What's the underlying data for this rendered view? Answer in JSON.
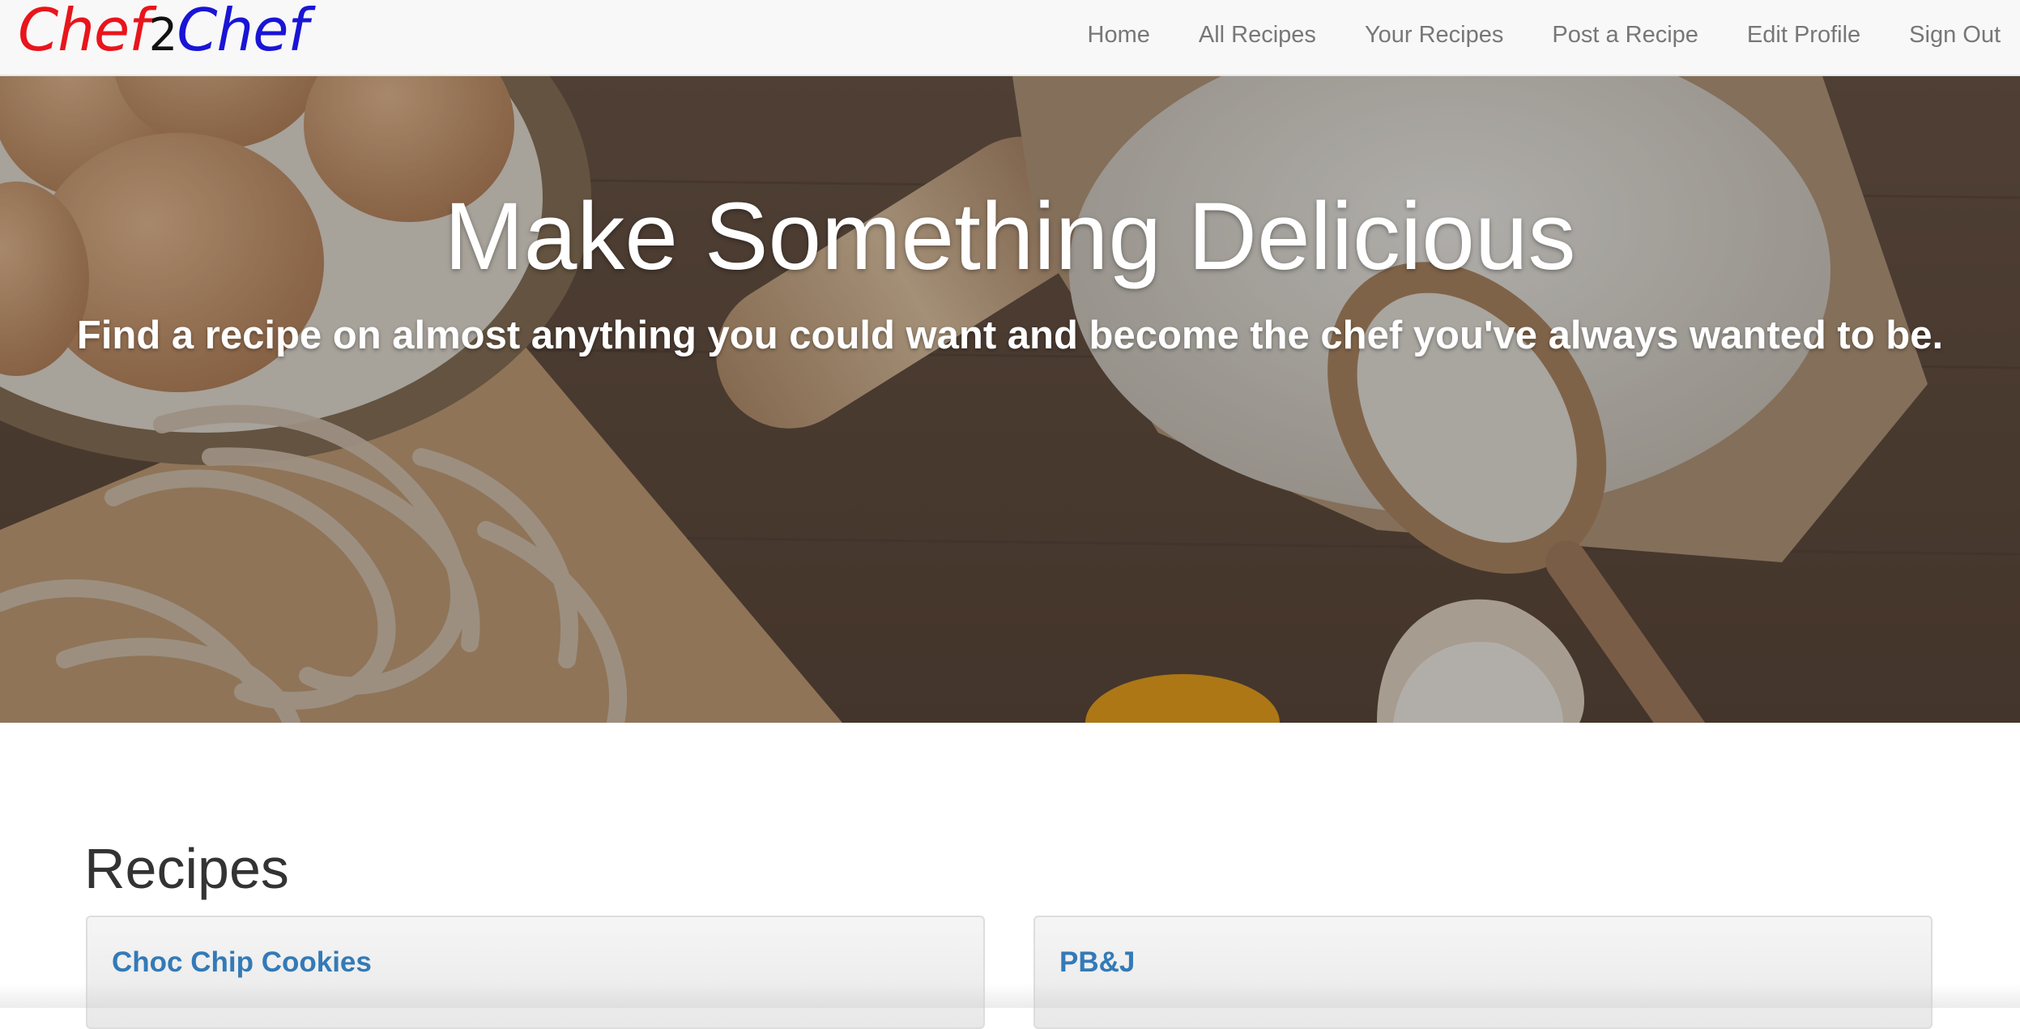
{
  "brand": {
    "part1": "Chef",
    "part2": "2",
    "part3": "Chef",
    "color1": "#e8151b",
    "color2": "#111111",
    "color3": "#1a14d6"
  },
  "nav": {
    "items": [
      {
        "label": "Home"
      },
      {
        "label": "All Recipes"
      },
      {
        "label": "Your Recipes"
      },
      {
        "label": "Post a Recipe"
      },
      {
        "label": "Edit Profile"
      },
      {
        "label": "Sign Out"
      }
    ]
  },
  "hero": {
    "title": "Make Something Delicious",
    "subtitle": "Find a recipe on almost anything you could want and become the chef you've always wanted to be."
  },
  "recipes": {
    "heading": "Recipes",
    "cards": [
      {
        "title": "Choc Chip Cookies"
      },
      {
        "title": "PB&J"
      }
    ]
  },
  "colors": {
    "link": "#337ab7",
    "nav_text": "#777777",
    "navbar_bg": "#f8f8f8"
  }
}
